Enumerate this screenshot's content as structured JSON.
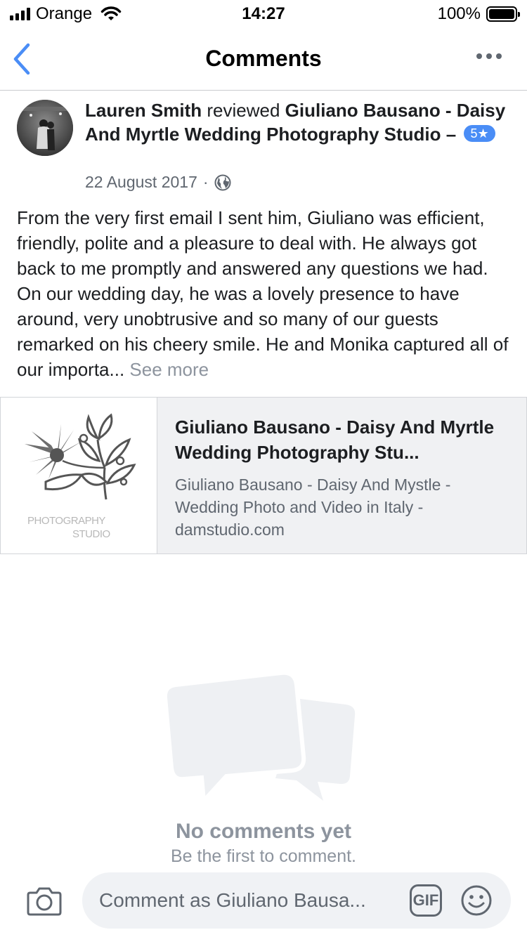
{
  "status_bar": {
    "carrier": "Orange",
    "time": "14:27",
    "battery": "100%"
  },
  "nav": {
    "title": "Comments",
    "back_icon": "chevron-left-icon",
    "more_icon": "more-horizontal-icon"
  },
  "post": {
    "author": "Lauren Smith",
    "action": "reviewed",
    "page_name": "Giuliano Bausano - Daisy And Myrtle Wedding Photography Studio",
    "dash": "–",
    "rating": "5★",
    "date": "22 August 2017",
    "separator": "·",
    "privacy_icon": "globe-icon",
    "body": "From the very first email I sent him, Giuliano was efficient, friendly, polite and a pleasure to deal with. He always got back to me promptly and answered any questions we had. On our wedding day, he was a lovely presence to have around, very unobtrusive and so many of our guests remarked on his cheery smile. He and Monika captured all of our importa...",
    "see_more": "See more"
  },
  "link_preview": {
    "title": "Giuliano Bausano - Daisy And Myrtle Wedding Photography Stu...",
    "description": "Giuliano Bausano - Daisy And Mystle - Wedding Photo and Video in Italy - damstudio.com",
    "thumb_line1": "PHOTOGRAPHY",
    "thumb_line2": "STUDIO"
  },
  "empty_state": {
    "title": "No comments yet",
    "subtitle": "Be the first to comment."
  },
  "composer": {
    "placeholder": "Comment as Giuliano Bausa...",
    "gif_label": "GIF",
    "camera_icon": "camera-icon",
    "emoji_icon": "emoji-icon"
  },
  "colors": {
    "accent": "#4a8df6",
    "secondary_text": "#606770",
    "muted": "#8d949e"
  }
}
